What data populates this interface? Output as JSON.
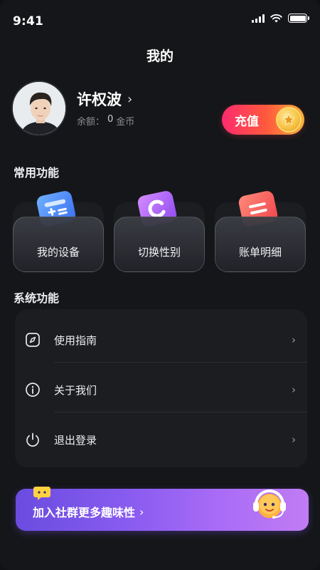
{
  "status_bar": {
    "time": "9:41"
  },
  "header": {
    "title": "我的"
  },
  "profile": {
    "name": "许权波",
    "balance_label": "余额：",
    "balance_value": "0",
    "balance_unit": "金币"
  },
  "recharge": {
    "label": "充值"
  },
  "common_features": {
    "title": "常用功能",
    "items": [
      {
        "label": "我的设备",
        "icon": "calculator-icon",
        "color": "#4f8bff"
      },
      {
        "label": "切换性别",
        "icon": "gender-switch-icon",
        "color": "#b264ff"
      },
      {
        "label": "账单明细",
        "icon": "bill-icon",
        "color": "#ff5f5f"
      }
    ]
  },
  "system_features": {
    "title": "系统功能",
    "items": [
      {
        "label": "使用指南",
        "icon": "compass-icon"
      },
      {
        "label": "关于我们",
        "icon": "info-icon"
      },
      {
        "label": "退出登录",
        "icon": "power-icon"
      }
    ]
  },
  "community": {
    "label": "加入社群更多趣味性"
  },
  "colors": {
    "background": "#151619",
    "card": "#1c1d21",
    "recharge_start": "#ff2b6e",
    "recharge_end": "#f7b23a",
    "community_start": "#6a4ce0",
    "community_end": "#c07cf4"
  }
}
